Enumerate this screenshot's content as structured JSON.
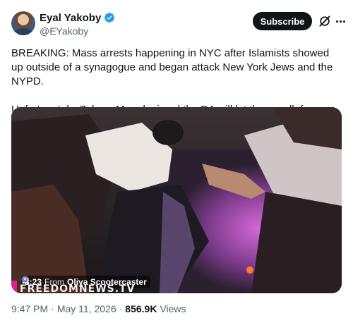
{
  "author": {
    "display_name": "Eyal Yakoby",
    "handle": "@EYakoby",
    "verified_color": "#1d9bf0"
  },
  "actions": {
    "subscribe_label": "Subscribe",
    "grok_icon": "grok-icon",
    "more_icon": "more-icon"
  },
  "tweet": {
    "paragraph_1": "BREAKING: Mass arrests happening in NYC after Islamists showed up outside of a synagogue and began attack New York Jews and the NYPD.",
    "paragraph_2": "Unfortunately, Zohran Mamdani and the DA will let them walk free."
  },
  "media": {
    "duration": "3:23",
    "from_label": "From",
    "channel": "Oliya Scootercaster",
    "watermark": "FREEDOMNEWS.TV"
  },
  "footer": {
    "time": "9:47 PM",
    "separator": "·",
    "date": "May 11, 2026",
    "views_count": "856.9K",
    "views_label": "Views"
  },
  "colors": {
    "text": "#0f1419",
    "secondary": "#536471",
    "accent": "#1d9bf0"
  }
}
